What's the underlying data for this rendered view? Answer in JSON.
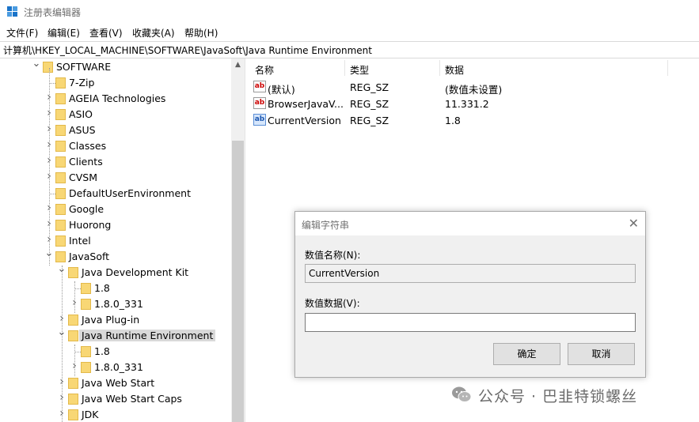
{
  "window": {
    "title": "注册表编辑器"
  },
  "menu": [
    "文件(F)",
    "编辑(E)",
    "查看(V)",
    "收藏夹(A)",
    "帮助(H)"
  ],
  "address": "计算机\\HKEY_LOCAL_MACHINE\\SOFTWARE\\JavaSoft\\Java Runtime Environment",
  "tree": [
    {
      "label": "SOFTWARE",
      "expander": "v"
    },
    {
      "label": "7-Zip",
      "expander": ""
    },
    {
      "label": "AGEIA Technologies",
      "expander": ">"
    },
    {
      "label": "ASIO",
      "expander": ">"
    },
    {
      "label": "ASUS",
      "expander": ">"
    },
    {
      "label": "Classes",
      "expander": ">"
    },
    {
      "label": "Clients",
      "expander": ">"
    },
    {
      "label": "CVSM",
      "expander": ">"
    },
    {
      "label": "DefaultUserEnvironment",
      "expander": ""
    },
    {
      "label": "Google",
      "expander": ">"
    },
    {
      "label": "Huorong",
      "expander": ">"
    },
    {
      "label": "Intel",
      "expander": ">"
    },
    {
      "label": "JavaSoft",
      "expander": "v"
    },
    {
      "label": "Java Development Kit",
      "expander": "v"
    },
    {
      "label": "1.8",
      "expander": ""
    },
    {
      "label": "1.8.0_331",
      "expander": ">"
    },
    {
      "label": "Java Plug-in",
      "expander": ">"
    },
    {
      "label": "Java Runtime Environment",
      "expander": "v",
      "selected": true
    },
    {
      "label": "1.8",
      "expander": ""
    },
    {
      "label": "1.8.0_331",
      "expander": ">"
    },
    {
      "label": "Java Web Start",
      "expander": ">"
    },
    {
      "label": "Java Web Start Caps",
      "expander": ">"
    },
    {
      "label": "JDK",
      "expander": ">"
    }
  ],
  "list": {
    "columns": [
      "名称",
      "类型",
      "数据"
    ],
    "rows": [
      {
        "name": "(默认)",
        "type": "REG_SZ",
        "data": "(数值未设置)",
        "icon": "string-value-icon"
      },
      {
        "name": "BrowserJavaV...",
        "type": "REG_SZ",
        "data": "11.331.2",
        "icon": "string-value-icon"
      },
      {
        "name": "CurrentVersion",
        "type": "REG_SZ",
        "data": "1.8",
        "icon": "string-value-icon"
      }
    ],
    "icon_text": "ab"
  },
  "dialog": {
    "title": "编辑字符串",
    "close_glyph": "✕",
    "name_label": "数值名称(N):",
    "name_value": "CurrentVersion",
    "data_label": "数值数据(V):",
    "data_value": "",
    "ok_label": "确定",
    "cancel_label": "取消"
  },
  "watermark": {
    "text": "公众号 · 巴韭特锁螺丝"
  },
  "colors": {
    "folder": "#f8d775",
    "selection": "#d9d9d9",
    "dialog_bg": "#f0f0f0",
    "app_icon": "#1a73c9"
  }
}
